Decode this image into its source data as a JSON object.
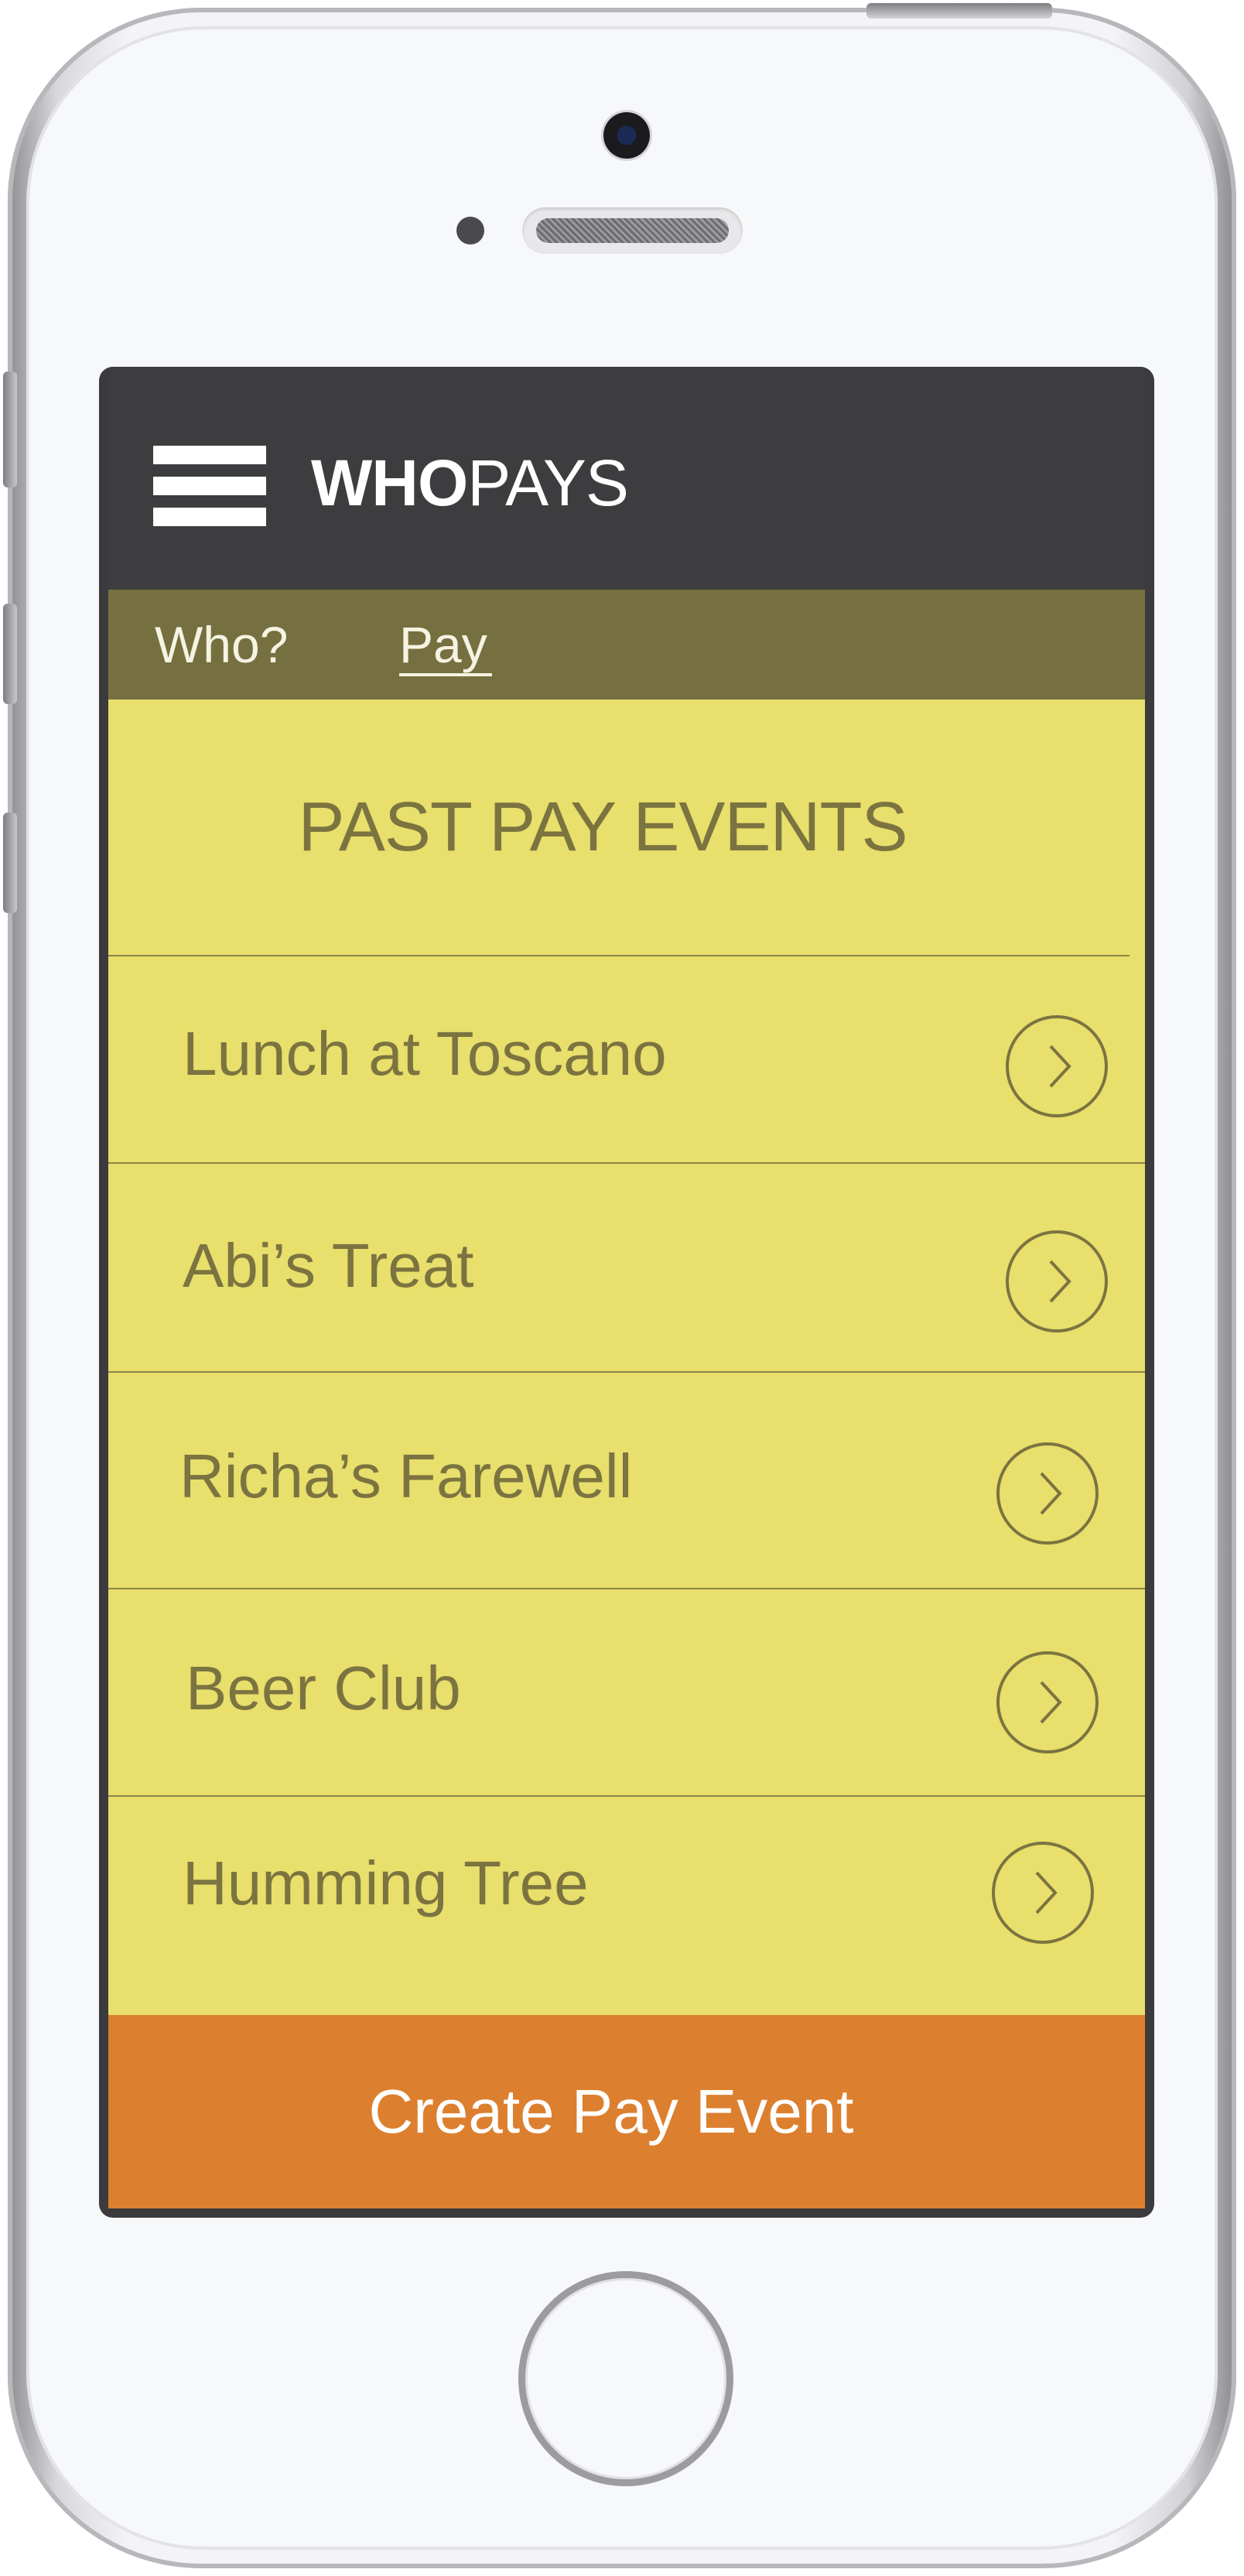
{
  "app": {
    "brand_bold": "WHO",
    "brand_light": "PAYS"
  },
  "tabs": [
    {
      "label": "Who?",
      "selected": false
    },
    {
      "label": "Pay",
      "selected": true
    }
  ],
  "main": {
    "section_title": "PAST PAY EVENTS",
    "events": [
      {
        "label": "Lunch at Toscano",
        "action_icon": "chevron-right-icon"
      },
      {
        "label": "Abi’s Treat",
        "action_icon": "chevron-right-icon"
      },
      {
        "label": "Richa’s Farewell",
        "action_icon": "chevron-right-icon"
      },
      {
        "label": "Beer Club",
        "action_icon": "chevron-right-icon"
      },
      {
        "label": "Humming Tree",
        "action_icon": "chevron-right-icon"
      }
    ],
    "create_button_label": "Create Pay Event"
  },
  "colors": {
    "app_bar": "#3d3d3f",
    "tab_bar": "#767040",
    "content_background": "#e8df6c",
    "text": "#7b7440",
    "create_button": "#dc7f2f"
  },
  "icons": {
    "menu": "hamburger-menu-icon",
    "event_action": "chevron-right-icon"
  }
}
